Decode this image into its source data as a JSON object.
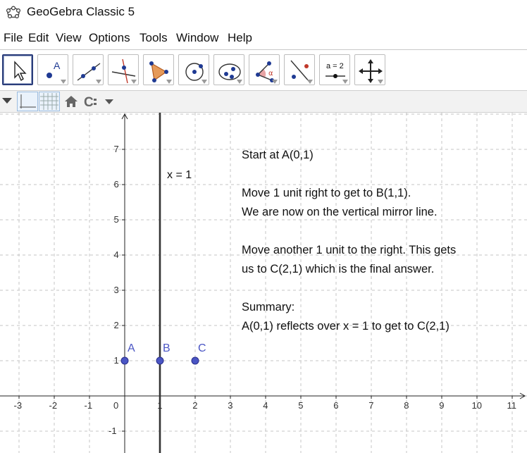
{
  "window": {
    "title": "GeoGebra Classic 5",
    "icon": "geogebra-icon"
  },
  "menu": [
    "File",
    "Edit",
    "View",
    "Options",
    "Tools",
    "Window",
    "Help"
  ],
  "toolbar": {
    "tools": [
      "move-tool-icon",
      "point-tool-icon",
      "line-tool-icon",
      "perpendicular-line-tool-icon",
      "polygon-tool-icon",
      "circle-tool-icon",
      "conic-tool-icon",
      "angle-tool-icon",
      "reflect-tool-icon",
      "slider-tool-icon",
      "move-graphics-view-tool-icon"
    ],
    "slider_label": "a = 2",
    "angle_symbol": "α"
  },
  "stylebar_icons": [
    "toggle-style-bar-icon",
    "show-axes-icon",
    "show-grid-icon",
    "home-icon",
    "point-capture-icon"
  ],
  "graphics": {
    "x_ticks": [
      "-3",
      "-2",
      "-1",
      "0",
      "1",
      "2",
      "3",
      "4",
      "5",
      "6",
      "7",
      "8",
      "9",
      "10",
      "11"
    ],
    "y_ticks": [
      "7",
      "6",
      "5",
      "4",
      "3",
      "2",
      "1",
      "-1"
    ],
    "line_label": "x = 1",
    "points": [
      {
        "name": "A",
        "x": 0,
        "y": 1
      },
      {
        "name": "B",
        "x": 1,
        "y": 1
      },
      {
        "name": "C",
        "x": 2,
        "y": 1
      }
    ],
    "vertical_line_x": 1,
    "point_color": "#4a55c4",
    "notes": [
      "Start at A(0,1)",
      "Move 1 unit right to get to B(1,1).",
      "We are now on the vertical mirror line.",
      "Move another 1 unit to the right. This gets",
      "us to C(2,1) which is the final answer.",
      "Summary:",
      "A(0,1) reflects over x = 1 to get to C(2,1)"
    ]
  }
}
